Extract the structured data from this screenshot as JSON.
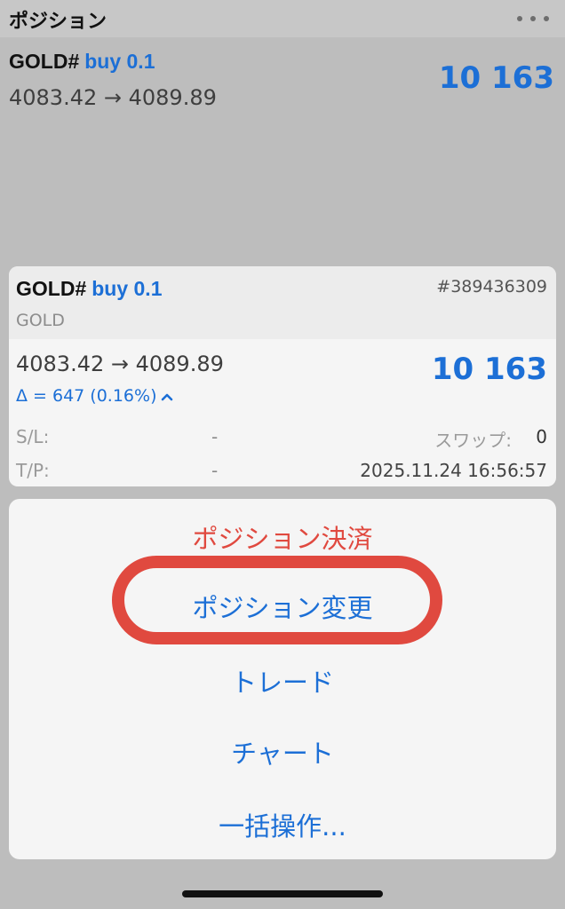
{
  "header": {
    "title": "ポジション",
    "more_icon": "more-horizontal-icon"
  },
  "position_row": {
    "symbol": "GOLD#",
    "direction": "buy 0.1",
    "prices": "4083.42 → 4089.89",
    "profit": "10 163"
  },
  "detail": {
    "symbol": "GOLD#",
    "direction": "buy 0.1",
    "ticket": "#389436309",
    "name": "GOLD",
    "prices": "4083.42 → 4089.89",
    "delta": "Δ = 647 (0.16%)",
    "delta_icon": "chevron-up-icon",
    "profit": "10 163",
    "sl_label": "S/L:",
    "sl_value": "-",
    "swap_label": "スワップ:",
    "swap_value": "0",
    "tp_label": "T/P:",
    "tp_value": "-",
    "time": "2025.11.24 16:56:57"
  },
  "actions": {
    "close": "ポジション決済",
    "modify": "ポジション変更",
    "trade": "トレード",
    "chart": "チャート",
    "bulk": "一括操作..."
  },
  "colors": {
    "accent": "#1c6fd6",
    "danger": "#e0493f",
    "overlay": "#bdbdbd"
  }
}
